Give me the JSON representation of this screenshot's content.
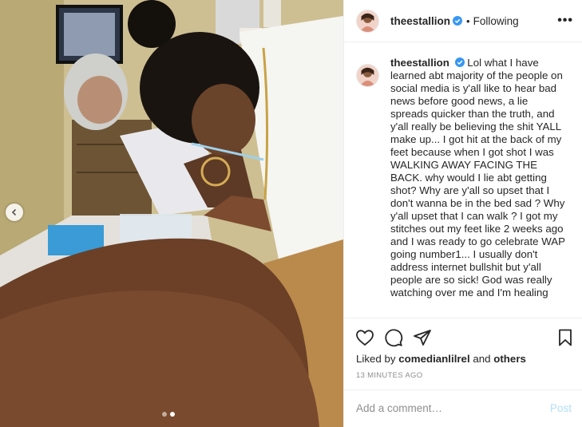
{
  "post": {
    "username": "theestallion",
    "verified": true,
    "separator": "•",
    "follow_status": "Following",
    "more_label": "•••",
    "caption": "Lol what I have learned abt majority of the people on social media is y'all like to hear bad news before good news, a lie spreads quicker than the truth, and y'all really be believing the shit YALL make up... I got hit at the back of my feet because when I got shot I was WALKING AWAY FACING THE BACK. why would I lie abt getting shot? Why are y'all so upset that I don't wanna be in the bed sad ? Why y'all upset that I can walk ? I got my stitches out my feet like 2 weeks ago and I was ready to go celebrate WAP going number1... I usually don't address internet bullshit but y'all people are so sick! God was really watching over me and I'm healing",
    "likes_prefix": "Liked by",
    "liked_by": "comedianlilrel",
    "likes_conjunction": "and",
    "likes_others": "others",
    "timestamp": "13 minutes ago"
  },
  "carousel": {
    "total_slides": 2,
    "active_slide": 2
  },
  "icons": {
    "like": "heart-icon",
    "comment": "comment-icon",
    "share": "paper-plane-icon",
    "save": "bookmark-icon",
    "verified": "verified-badge-icon",
    "prev": "chevron-left-icon"
  },
  "comment": {
    "placeholder": "Add a comment…",
    "post_label": "Post"
  },
  "colors": {
    "verified_blue": "#3897f0",
    "post_disabled": "#b2dffc",
    "muted_text": "#8e8e8e"
  }
}
